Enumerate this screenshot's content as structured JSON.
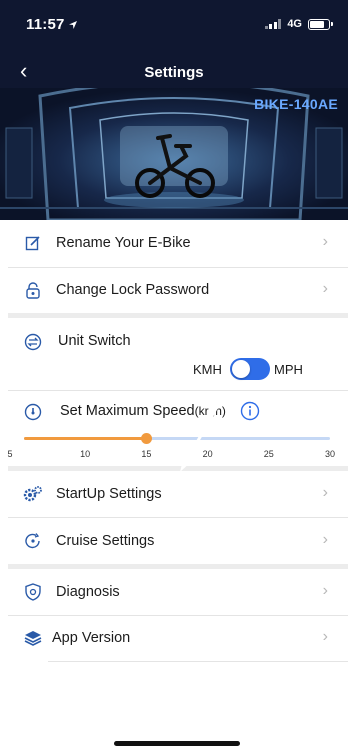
{
  "status_bar": {
    "time": "11:57",
    "network": "4G"
  },
  "header": {
    "back": "‹",
    "title": "Settings"
  },
  "banner": {
    "bike_code": "BIKE-140AE"
  },
  "menu": {
    "rename": "Rename Your E-Bike",
    "lock": "Change Lock Password",
    "startup": "StartUp Settings",
    "cruise": "Cruise Settings",
    "diagnosis": "Diagnosis",
    "app_version": "App Version"
  },
  "chevron": "›",
  "unit_switch": {
    "label": "Unit Switch",
    "left_option": "KMH",
    "right_option": "MPH",
    "selected": "KMH"
  },
  "speed": {
    "label": "Set Maximum Speed",
    "unit_fragment": "(kr ,h)",
    "min": 5,
    "max": 30,
    "value": 15,
    "ticks": [
      "5",
      "10",
      "15",
      "20",
      "25",
      "30"
    ]
  },
  "colors": {
    "accent": "#2f6de8",
    "slider_fill": "#f19a3e",
    "header_bg": "#0f1730",
    "bike_code": "#6aa8ff"
  }
}
